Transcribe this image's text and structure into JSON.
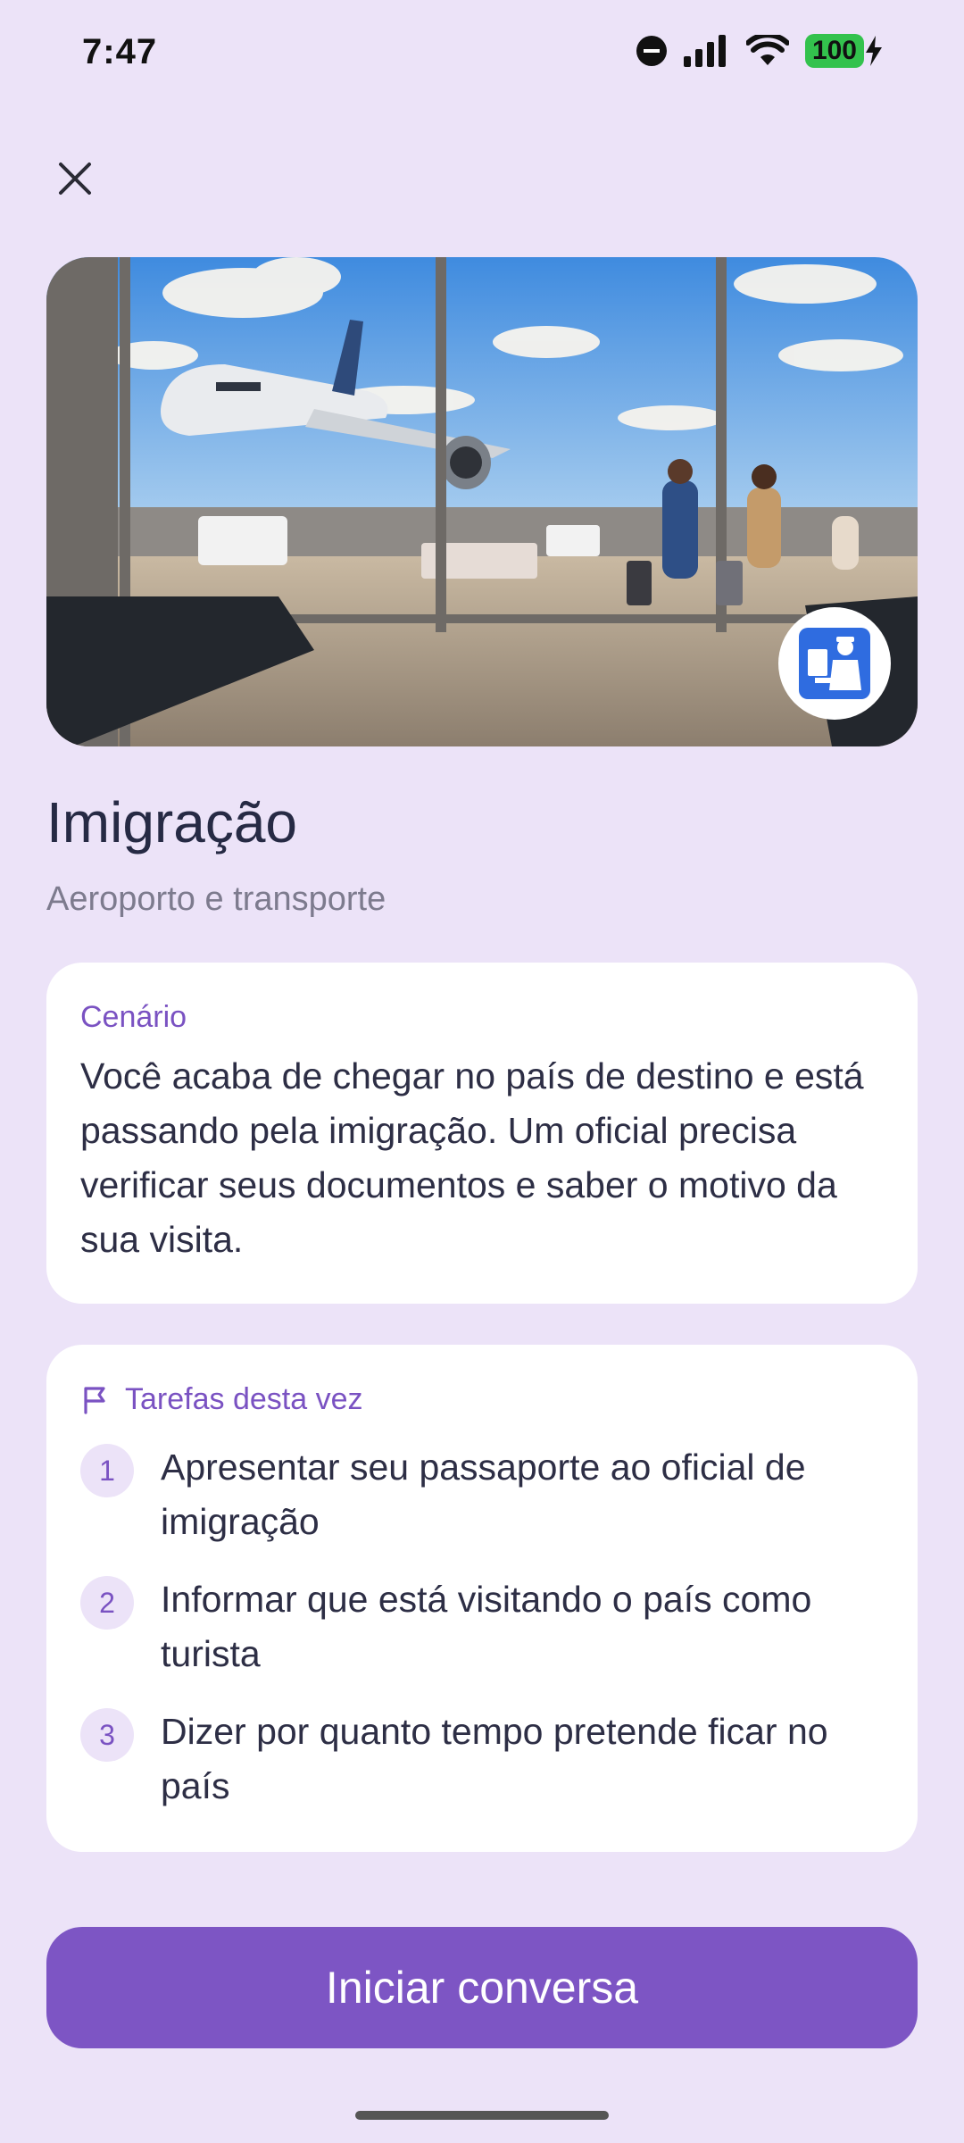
{
  "status_bar": {
    "time": "7:47",
    "battery": "100"
  },
  "hero": {
    "image_desc_icon": "airplane-terminal-illustration",
    "badge_icon": "immigration-officer-icon"
  },
  "header": {
    "title": "Imigração",
    "subtitle": "Aeroporto e transporte"
  },
  "scenario": {
    "label": "Cenário",
    "text": "Você acaba de chegar no país de destino e está passando pela imigração. Um oficial precisa verificar seus documentos e saber o motivo da sua visita."
  },
  "tasks": {
    "label": "Tarefas desta vez",
    "items": [
      {
        "num": "1",
        "text": "Apresentar seu passaporte ao oficial de imigração"
      },
      {
        "num": "2",
        "text": "Informar que está visitando o país como turista"
      },
      {
        "num": "3",
        "text": "Dizer por quanto tempo pretende ficar no país"
      }
    ]
  },
  "cta": {
    "label": "Iniciar conversa"
  },
  "colors": {
    "background": "#ECE3F8",
    "accent": "#7D55C4",
    "card": "#FFFFFF"
  }
}
